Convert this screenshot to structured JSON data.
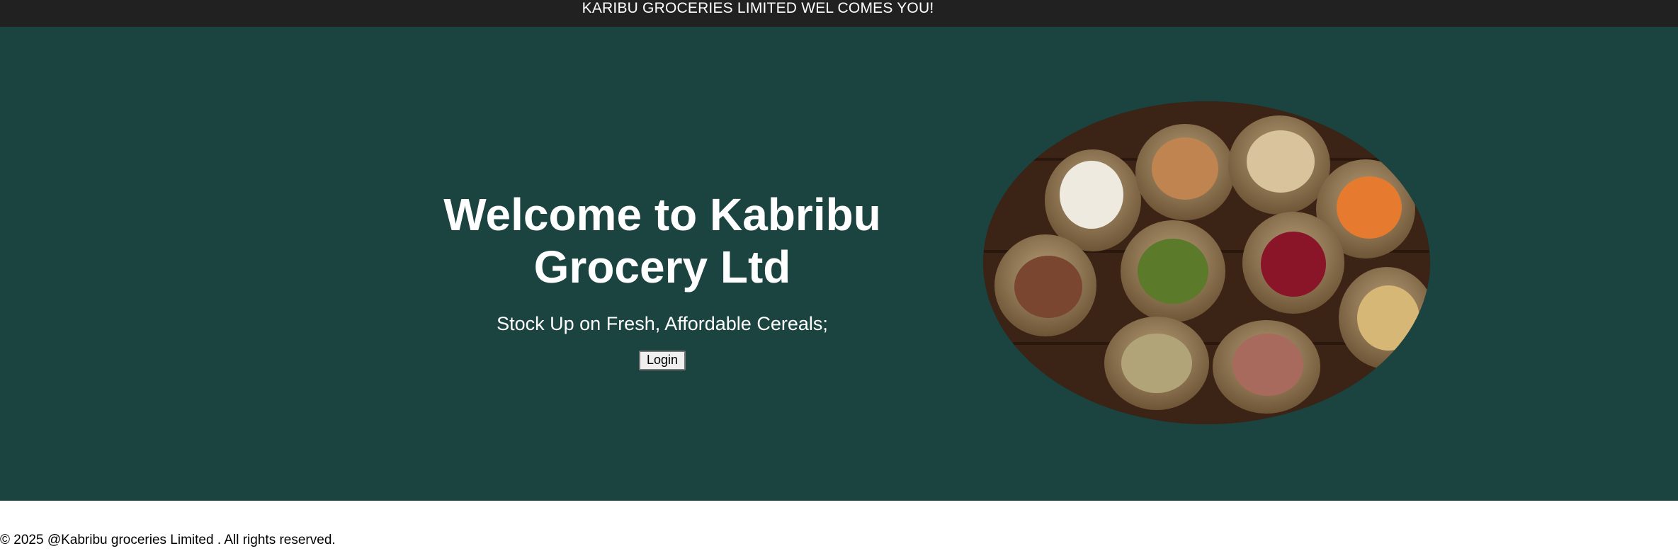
{
  "topbar": {
    "text": "KARIBU GROCERIES LIMITED WEL COMES YOU!"
  },
  "hero": {
    "title": "Welcome to Kabribu Grocery Ltd",
    "subtitle": "Stock Up on Fresh, Affordable Cereals;",
    "login_label": "Login"
  },
  "footer": {
    "text": "© 2025 @Kabribu groceries Limited . All rights reserved."
  },
  "colors": {
    "topbar_bg": "#212121",
    "hero_bg": "#1b4441",
    "text_light": "#ffffff"
  }
}
